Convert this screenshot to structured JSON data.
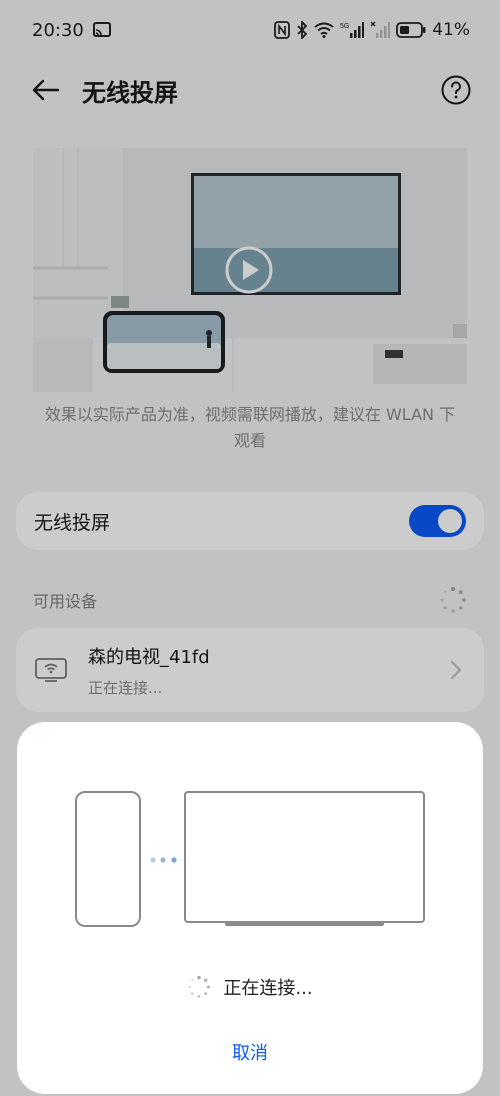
{
  "status_bar": {
    "time": "20:30",
    "battery_pct": "41%",
    "network_label": "5G",
    "icons": [
      "cast-icon",
      "nfc-icon",
      "bluetooth-icon",
      "wifi-icon",
      "signal-icon",
      "signal-off-icon",
      "battery-icon"
    ]
  },
  "app_bar": {
    "title": "无线投屏",
    "back_icon": "arrow-left-icon",
    "help_icon": "help-circle-icon"
  },
  "hero": {
    "note": "效果以实际产品为准，视频需联网播放，建议在 WLAN 下观看",
    "play_icon": "play-icon"
  },
  "toggle": {
    "label": "无线投屏",
    "on": true
  },
  "section": {
    "title": "可用设备",
    "loading_icon": "spinner-icon"
  },
  "device": {
    "name": "森的电视_41fd",
    "status": "正在连接...",
    "icon": "tv-wifi-icon"
  },
  "dialog": {
    "connecting_text": "正在连接...",
    "cancel_label": "取消"
  },
  "colors": {
    "accent": "#0a59f7",
    "background": "#f1f3f5",
    "secondary_text": "#8a8a8a"
  }
}
